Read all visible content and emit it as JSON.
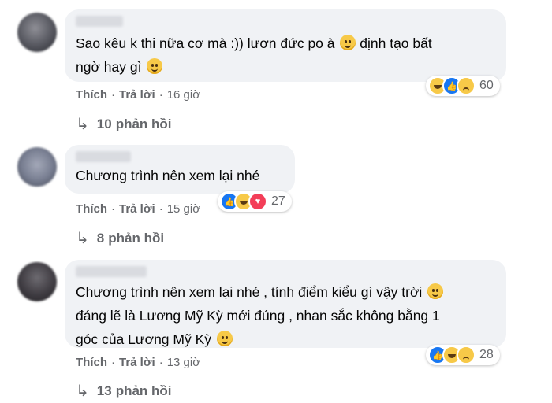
{
  "comments": [
    {
      "text_line1": "Sao kêu k thi nữa cơ mà :)) lươn đức po à",
      "text_line1_b": "định tạo bất",
      "text_line2": "ngờ hay gì",
      "reaction_count": "60",
      "like_label": "Thích",
      "reply_label": "Trả lời",
      "time": "16 giờ",
      "replies_count": "10",
      "replies_label": "phản hồi"
    },
    {
      "text_line1": "Chương trình nên xem lại nhé",
      "reaction_count": "27",
      "like_label": "Thích",
      "reply_label": "Trả lời",
      "time": "15 giờ",
      "replies_count": "8",
      "replies_label": "phản hồi"
    },
    {
      "text_line1": "Chương trình nên xem lại nhé , tính điểm kiểu gì vậy trời",
      "text_line2": "đáng lẽ là Lương Mỹ Kỳ mới đúng , nhan sắc không bằng 1",
      "text_line3": "góc của Lương Mỹ Kỳ",
      "reaction_count": "28",
      "like_label": "Thích",
      "reply_label": "Trả lời",
      "time": "13 giờ",
      "replies_count": "13",
      "replies_label": "phản hồi"
    }
  ],
  "icons": {
    "reply_arrow": "reply-arrow-icon",
    "reactions": [
      "haha-icon",
      "like-icon",
      "sad-icon",
      "love-icon"
    ]
  },
  "colors": {
    "bubble_bg": "#f0f2f5",
    "meta_text": "#65676b",
    "like_blue": "#1877f2",
    "love_red": "#f33e58",
    "emoji_yellow": "#f7c948"
  }
}
